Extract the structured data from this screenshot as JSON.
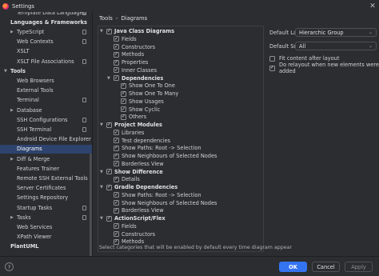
{
  "window": {
    "title": "Settings",
    "close_glyph": "✕"
  },
  "colors": {
    "accent": "#3574f0",
    "selection": "#2e436e",
    "background": "#2b2d30"
  },
  "sidebar": {
    "items": [
      {
        "label": "Template Data Languages",
        "indent": 2,
        "pinned": true,
        "partial": true
      },
      {
        "label": "Languages & Frameworks",
        "indent": 0,
        "section": true
      },
      {
        "label": "TypeScript",
        "indent": 1,
        "arrow": "collapsed",
        "pinned": true
      },
      {
        "label": "Web Contexts",
        "indent": 1,
        "pinned": true
      },
      {
        "label": "XSLT",
        "indent": 1
      },
      {
        "label": "XSLT File Associations",
        "indent": 1,
        "pinned": true
      },
      {
        "label": "Tools",
        "indent": 0,
        "section": true,
        "arrow": "expanded"
      },
      {
        "label": "Web Browsers",
        "indent": 1
      },
      {
        "label": "External Tools",
        "indent": 1
      },
      {
        "label": "Terminal",
        "indent": 1,
        "pinned": true
      },
      {
        "label": "Database",
        "indent": 1,
        "arrow": "collapsed"
      },
      {
        "label": "SSH Configurations",
        "indent": 1,
        "pinned": true
      },
      {
        "label": "SSH Terminal",
        "indent": 1,
        "pinned": true
      },
      {
        "label": "Android Device File Explorer",
        "indent": 1
      },
      {
        "label": "Diagrams",
        "indent": 1,
        "selected": true
      },
      {
        "label": "Diff & Merge",
        "indent": 1,
        "arrow": "collapsed"
      },
      {
        "label": "Features Trainer",
        "indent": 1
      },
      {
        "label": "Remote SSH External Tools",
        "indent": 1
      },
      {
        "label": "Server Certificates",
        "indent": 1
      },
      {
        "label": "Settings Repository",
        "indent": 1
      },
      {
        "label": "Startup Tasks",
        "indent": 1,
        "pinned": true
      },
      {
        "label": "Tasks",
        "indent": 1,
        "arrow": "collapsed",
        "pinned": true
      },
      {
        "label": "Web Services",
        "indent": 1
      },
      {
        "label": "XPath Viewer",
        "indent": 1
      },
      {
        "label": "PlantUML",
        "indent": 0,
        "section": true
      }
    ]
  },
  "breadcrumb": {
    "parent": "Tools",
    "separator": "›",
    "current": "Diagrams"
  },
  "tree": {
    "rows": [
      {
        "label": "Java Class Diagrams",
        "level": 0,
        "arrow": "expanded",
        "checked": true,
        "bold": true
      },
      {
        "label": "Fields",
        "level": 1,
        "checked": true
      },
      {
        "label": "Constructors",
        "level": 1,
        "checked": true
      },
      {
        "label": "Methods",
        "level": 1,
        "checked": true
      },
      {
        "label": "Properties",
        "level": 1,
        "checked": true
      },
      {
        "label": "Inner Classes",
        "level": 1,
        "checked": true
      },
      {
        "label": "Dependencies",
        "level": 1,
        "arrow": "expanded",
        "checked": true,
        "bold": true
      },
      {
        "label": "Show One To One",
        "level": 2,
        "checked": true
      },
      {
        "label": "Show One To Many",
        "level": 2,
        "checked": true
      },
      {
        "label": "Show Usages",
        "level": 2,
        "checked": true
      },
      {
        "label": "Show Cyclic",
        "level": 2,
        "checked": true
      },
      {
        "label": "Others",
        "level": 2,
        "checked": true
      },
      {
        "label": "Project Modules",
        "level": 0,
        "arrow": "expanded",
        "checked": true,
        "bold": true
      },
      {
        "label": "Libraries",
        "level": 1,
        "checked": true
      },
      {
        "label": "Test dependencies",
        "level": 1,
        "checked": true
      },
      {
        "label": "Show Paths: Root -> Selection",
        "level": 1,
        "checked": true
      },
      {
        "label": "Show Neighbours of Selected Nodes",
        "level": 1,
        "checked": true
      },
      {
        "label": "Borderless View",
        "level": 1,
        "checked": true
      },
      {
        "label": "Show Difference",
        "level": 0,
        "arrow": "expanded",
        "checked": true,
        "bold": true
      },
      {
        "label": "Details",
        "level": 1,
        "checked": true
      },
      {
        "label": "Gradle Dependencies",
        "level": 0,
        "arrow": "expanded",
        "checked": true,
        "bold": true
      },
      {
        "label": "Show Paths: Root -> Selection",
        "level": 1,
        "checked": true
      },
      {
        "label": "Show Neighbours of Selected Nodes",
        "level": 1,
        "checked": true
      },
      {
        "label": "Borderless View",
        "level": 1,
        "checked": true
      },
      {
        "label": "ActionScript/Flex",
        "level": 0,
        "arrow": "expanded",
        "checked": true,
        "bold": true
      },
      {
        "label": "Fields",
        "level": 1,
        "checked": true
      },
      {
        "label": "Constructors",
        "level": 1,
        "checked": true
      },
      {
        "label": "Methods",
        "level": 1,
        "checked": true
      }
    ],
    "hint": "Select categories that will be enabled by default every time diagram appear"
  },
  "options": {
    "layout_label": "Default Layout:",
    "layout_value": "Hierarchic Group",
    "scope_label": "Default Scope:",
    "scope_value": "All",
    "fit_label": "Fit content after layout",
    "fit_checked": false,
    "relayout_label": "Do relayout when new elements were added",
    "relayout_checked": true
  },
  "footer": {
    "help": "?",
    "ok": "OK",
    "cancel": "Cancel",
    "apply": "Apply"
  }
}
